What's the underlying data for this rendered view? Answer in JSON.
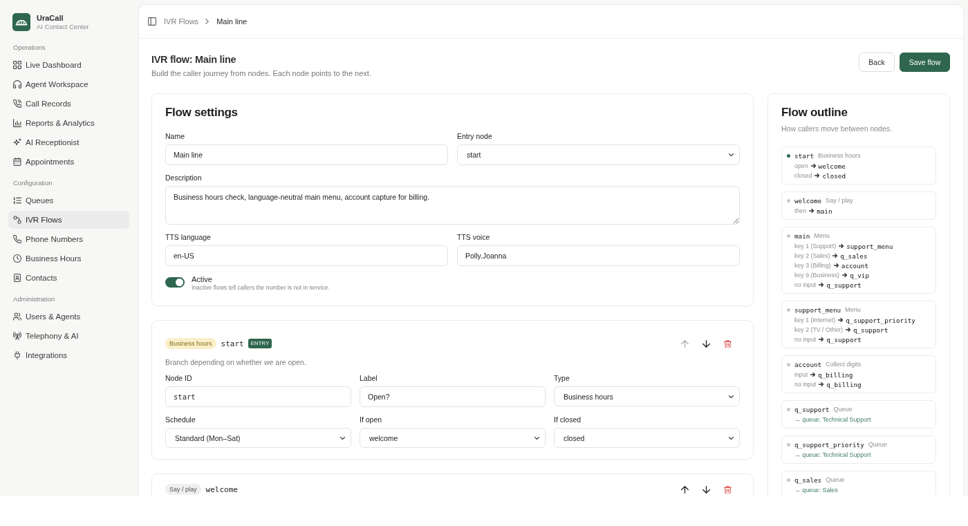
{
  "sidebar": {
    "brand": {
      "name": "UraCall",
      "tagline": "AI Contact Center"
    },
    "sections": [
      {
        "title": "Operations",
        "items": [
          {
            "label": "Live Dashboard",
            "selected": false
          },
          {
            "label": "Agent Workspace",
            "selected": false
          },
          {
            "label": "Call Records",
            "selected": false
          },
          {
            "label": "Reports & Analytics",
            "selected": false
          },
          {
            "label": "AI Receptionist",
            "selected": false
          },
          {
            "label": "Appointments",
            "selected": false
          }
        ]
      },
      {
        "title": "Configuration",
        "items": [
          {
            "label": "Queues",
            "selected": false
          },
          {
            "label": "IVR Flows",
            "selected": true
          },
          {
            "label": "Phone Numbers",
            "selected": false
          },
          {
            "label": "Business Hours",
            "selected": false
          },
          {
            "label": "Contacts",
            "selected": false
          }
        ]
      },
      {
        "title": "Administration",
        "items": [
          {
            "label": "Users & Agents",
            "selected": false
          },
          {
            "label": "Telephony & AI",
            "selected": false
          },
          {
            "label": "Integrations",
            "selected": false
          }
        ]
      }
    ]
  },
  "breadcrumb": [
    {
      "label": "IVR Flows",
      "current": false
    },
    {
      "label": "Main line",
      "current": true
    }
  ],
  "page": {
    "title": "IVR flow: Main line",
    "subtitle": "Build the caller journey from nodes. Each node points to the next.",
    "buttons": [
      {
        "label": "Back",
        "kind": "secondary"
      },
      {
        "label": "Save flow",
        "kind": "primary"
      }
    ]
  },
  "flow_settings": {
    "title": "Flow settings",
    "fields": [
      {
        "label": "Name",
        "kind": "text",
        "value": "Main line"
      },
      {
        "label": "Entry node",
        "kind": "select",
        "value": "start"
      },
      {
        "label": "Description",
        "kind": "textarea",
        "value": "Business hours check, language-neutral main menu, account capture for billing."
      },
      {
        "label": "TTS language",
        "kind": "text",
        "value": "en-US"
      },
      {
        "label": "TTS voice",
        "kind": "text",
        "value": "Polly.Joanna"
      }
    ],
    "active": {
      "label": "Active",
      "hint": "Inactive flows tell callers the number is not in service.",
      "on": true
    }
  },
  "nodes": [
    {
      "type": "Business hours",
      "color": "#faefc8",
      "id": "start",
      "badge": "ENTRY",
      "description": "Branch depending on whether we are open.",
      "actions": [
        {
          "kind": "up",
          "disabled": true
        },
        {
          "kind": "down",
          "disabled": false
        },
        {
          "kind": "delete",
          "disabled": false
        }
      ],
      "fields": [
        {
          "label": "Node ID",
          "kind": "mono",
          "value": "start"
        },
        {
          "label": "Label",
          "kind": "text",
          "value": "Open?"
        },
        {
          "label": "Type",
          "kind": "select",
          "value": "Business hours"
        },
        {
          "label": "Schedule",
          "kind": "select",
          "value": "Standard (Mon–Sat)"
        },
        {
          "label": "If open",
          "kind": "select",
          "value": "welcome"
        },
        {
          "label": "If closed",
          "kind": "select",
          "value": "closed"
        }
      ]
    },
    {
      "type": "Say / play",
      "color": "#efefef",
      "id": "welcome",
      "actions": [
        {
          "kind": "up",
          "disabled": false
        },
        {
          "kind": "down",
          "disabled": false
        },
        {
          "kind": "delete",
          "disabled": false
        }
      ]
    }
  ],
  "outline": {
    "title": "Flow outline",
    "subtitle": "How callers move between nodes.",
    "items": [
      {
        "id": "start",
        "type": "Business hours",
        "entry": true,
        "lines": [
          {
            "kind": "route",
            "condition": "open",
            "target": "welcome"
          },
          {
            "kind": "route",
            "condition": "closed",
            "target": "closed"
          }
        ]
      },
      {
        "id": "welcome",
        "type": "Say / play",
        "entry": false,
        "lines": [
          {
            "kind": "route",
            "condition": "then",
            "target": "main"
          }
        ]
      },
      {
        "id": "main",
        "type": "Menu",
        "entry": false,
        "lines": [
          {
            "kind": "route",
            "condition": "key 1 (Support)",
            "target": "support_menu"
          },
          {
            "kind": "route",
            "condition": "key 2 (Sales)",
            "target": "q_sales"
          },
          {
            "kind": "route",
            "condition": "key 3 (Billing)",
            "target": "account"
          },
          {
            "kind": "route",
            "condition": "key 9 (Business)",
            "target": "q_vip"
          },
          {
            "kind": "route",
            "condition": "no input",
            "target": "q_support"
          }
        ]
      },
      {
        "id": "support_menu",
        "type": "Menu",
        "entry": false,
        "lines": [
          {
            "kind": "route",
            "condition": "key 1 (Internet)",
            "target": "q_support_priority"
          },
          {
            "kind": "route",
            "condition": "key 2 (TV / Other)",
            "target": "q_support"
          },
          {
            "kind": "route",
            "condition": "no input",
            "target": "q_support"
          }
        ]
      },
      {
        "id": "account",
        "type": "Collect digits",
        "entry": false,
        "lines": [
          {
            "kind": "route",
            "condition": "input",
            "target": "q_billing"
          },
          {
            "kind": "route",
            "condition": "no input",
            "target": "q_billing"
          }
        ]
      },
      {
        "id": "q_support",
        "type": "Queue",
        "entry": false,
        "lines": [
          {
            "kind": "queue",
            "text": "→ queue: Technical Support"
          }
        ]
      },
      {
        "id": "q_support_priority",
        "type": "Queue",
        "entry": false,
        "lines": [
          {
            "kind": "queue",
            "text": "→ queue: Technical Support"
          }
        ]
      },
      {
        "id": "q_sales",
        "type": "Queue",
        "entry": false,
        "lines": [
          {
            "kind": "queue",
            "text": "→ queue: Sales"
          }
        ]
      }
    ]
  }
}
